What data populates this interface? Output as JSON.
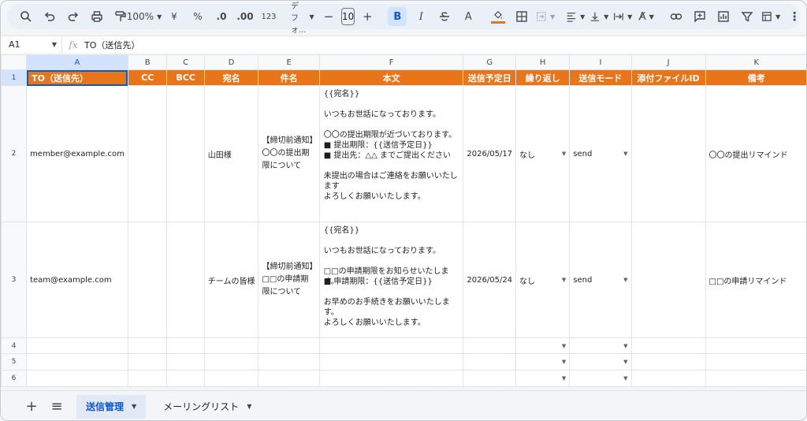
{
  "toolbar": {
    "zoom": "100%",
    "currency": "¥",
    "percent": "%",
    "dec_decrease": ".0",
    "dec_increase": ".00",
    "number_format": "123",
    "font": "デフォ...",
    "font_size": "10",
    "minus": "−",
    "plus": "+",
    "bold": "B",
    "italic": "I",
    "text_color": "A"
  },
  "formula_bar": {
    "cell_ref": "A1",
    "fx": "fx",
    "content": "TO（送信先）"
  },
  "columns": [
    "A",
    "B",
    "C",
    "D",
    "E",
    "F",
    "G",
    "H",
    "I",
    "J",
    "K"
  ],
  "rows": {
    "r1": "1",
    "r2": "2",
    "r3": "3",
    "r4": "4",
    "r5": "5",
    "r6": "6"
  },
  "headers": {
    "to": "TO（送信先）",
    "cc": "CC",
    "bcc": "BCC",
    "name": "宛名",
    "subject": "件名",
    "body": "本文",
    "date": "送信予定日",
    "repeat": "繰り返し",
    "mode": "送信モード",
    "attach": "添付ファイルID",
    "note": "備考"
  },
  "row2": {
    "to": "member@example.com",
    "cc": "",
    "bcc": "",
    "name": "山田様",
    "subject": "【締切前通知】〇〇の提出期限について",
    "body": [
      "{{宛名}}",
      "",
      "いつもお世話になっております。",
      "",
      "〇〇の提出期限が近づいております。",
      "■ 提出期限：{{送信予定日}}",
      "■ 提出先：△△ までご提出ください",
      "",
      "未提出の場合はご連絡をお願いいたします",
      "",
      "よろしくお願いいたします。"
    ],
    "date": "2026/05/17",
    "repeat": "なし",
    "mode": "send",
    "attach": "",
    "note": "〇〇の提出リマインド"
  },
  "row3": {
    "to": "team@example.com",
    "cc": "",
    "bcc": "",
    "name": "チームの皆様",
    "subject": "【締切前通知】□□の申請期限について",
    "body": [
      "{{宛名}}",
      "",
      "いつもお世話になっております。",
      "",
      "□□の申請期限をお知らせいたします。",
      "■ 申請期限：{{送信予定日}}",
      "",
      "お早めのお手続きをお願いいたします。",
      "",
      "よろしくお願いいたします。"
    ],
    "date": "2026/05/24",
    "repeat": "なし",
    "mode": "send",
    "attach": "",
    "note": "□□の申請リマインド"
  },
  "sheets": {
    "add": "+",
    "list": "≡",
    "active": "送信管理",
    "other": "メーリングリスト"
  },
  "colors": {
    "header_bg": "#e8751a",
    "header_text": "#ffffff",
    "selection": "#d3e3fd",
    "accent": "#0b57d0"
  }
}
